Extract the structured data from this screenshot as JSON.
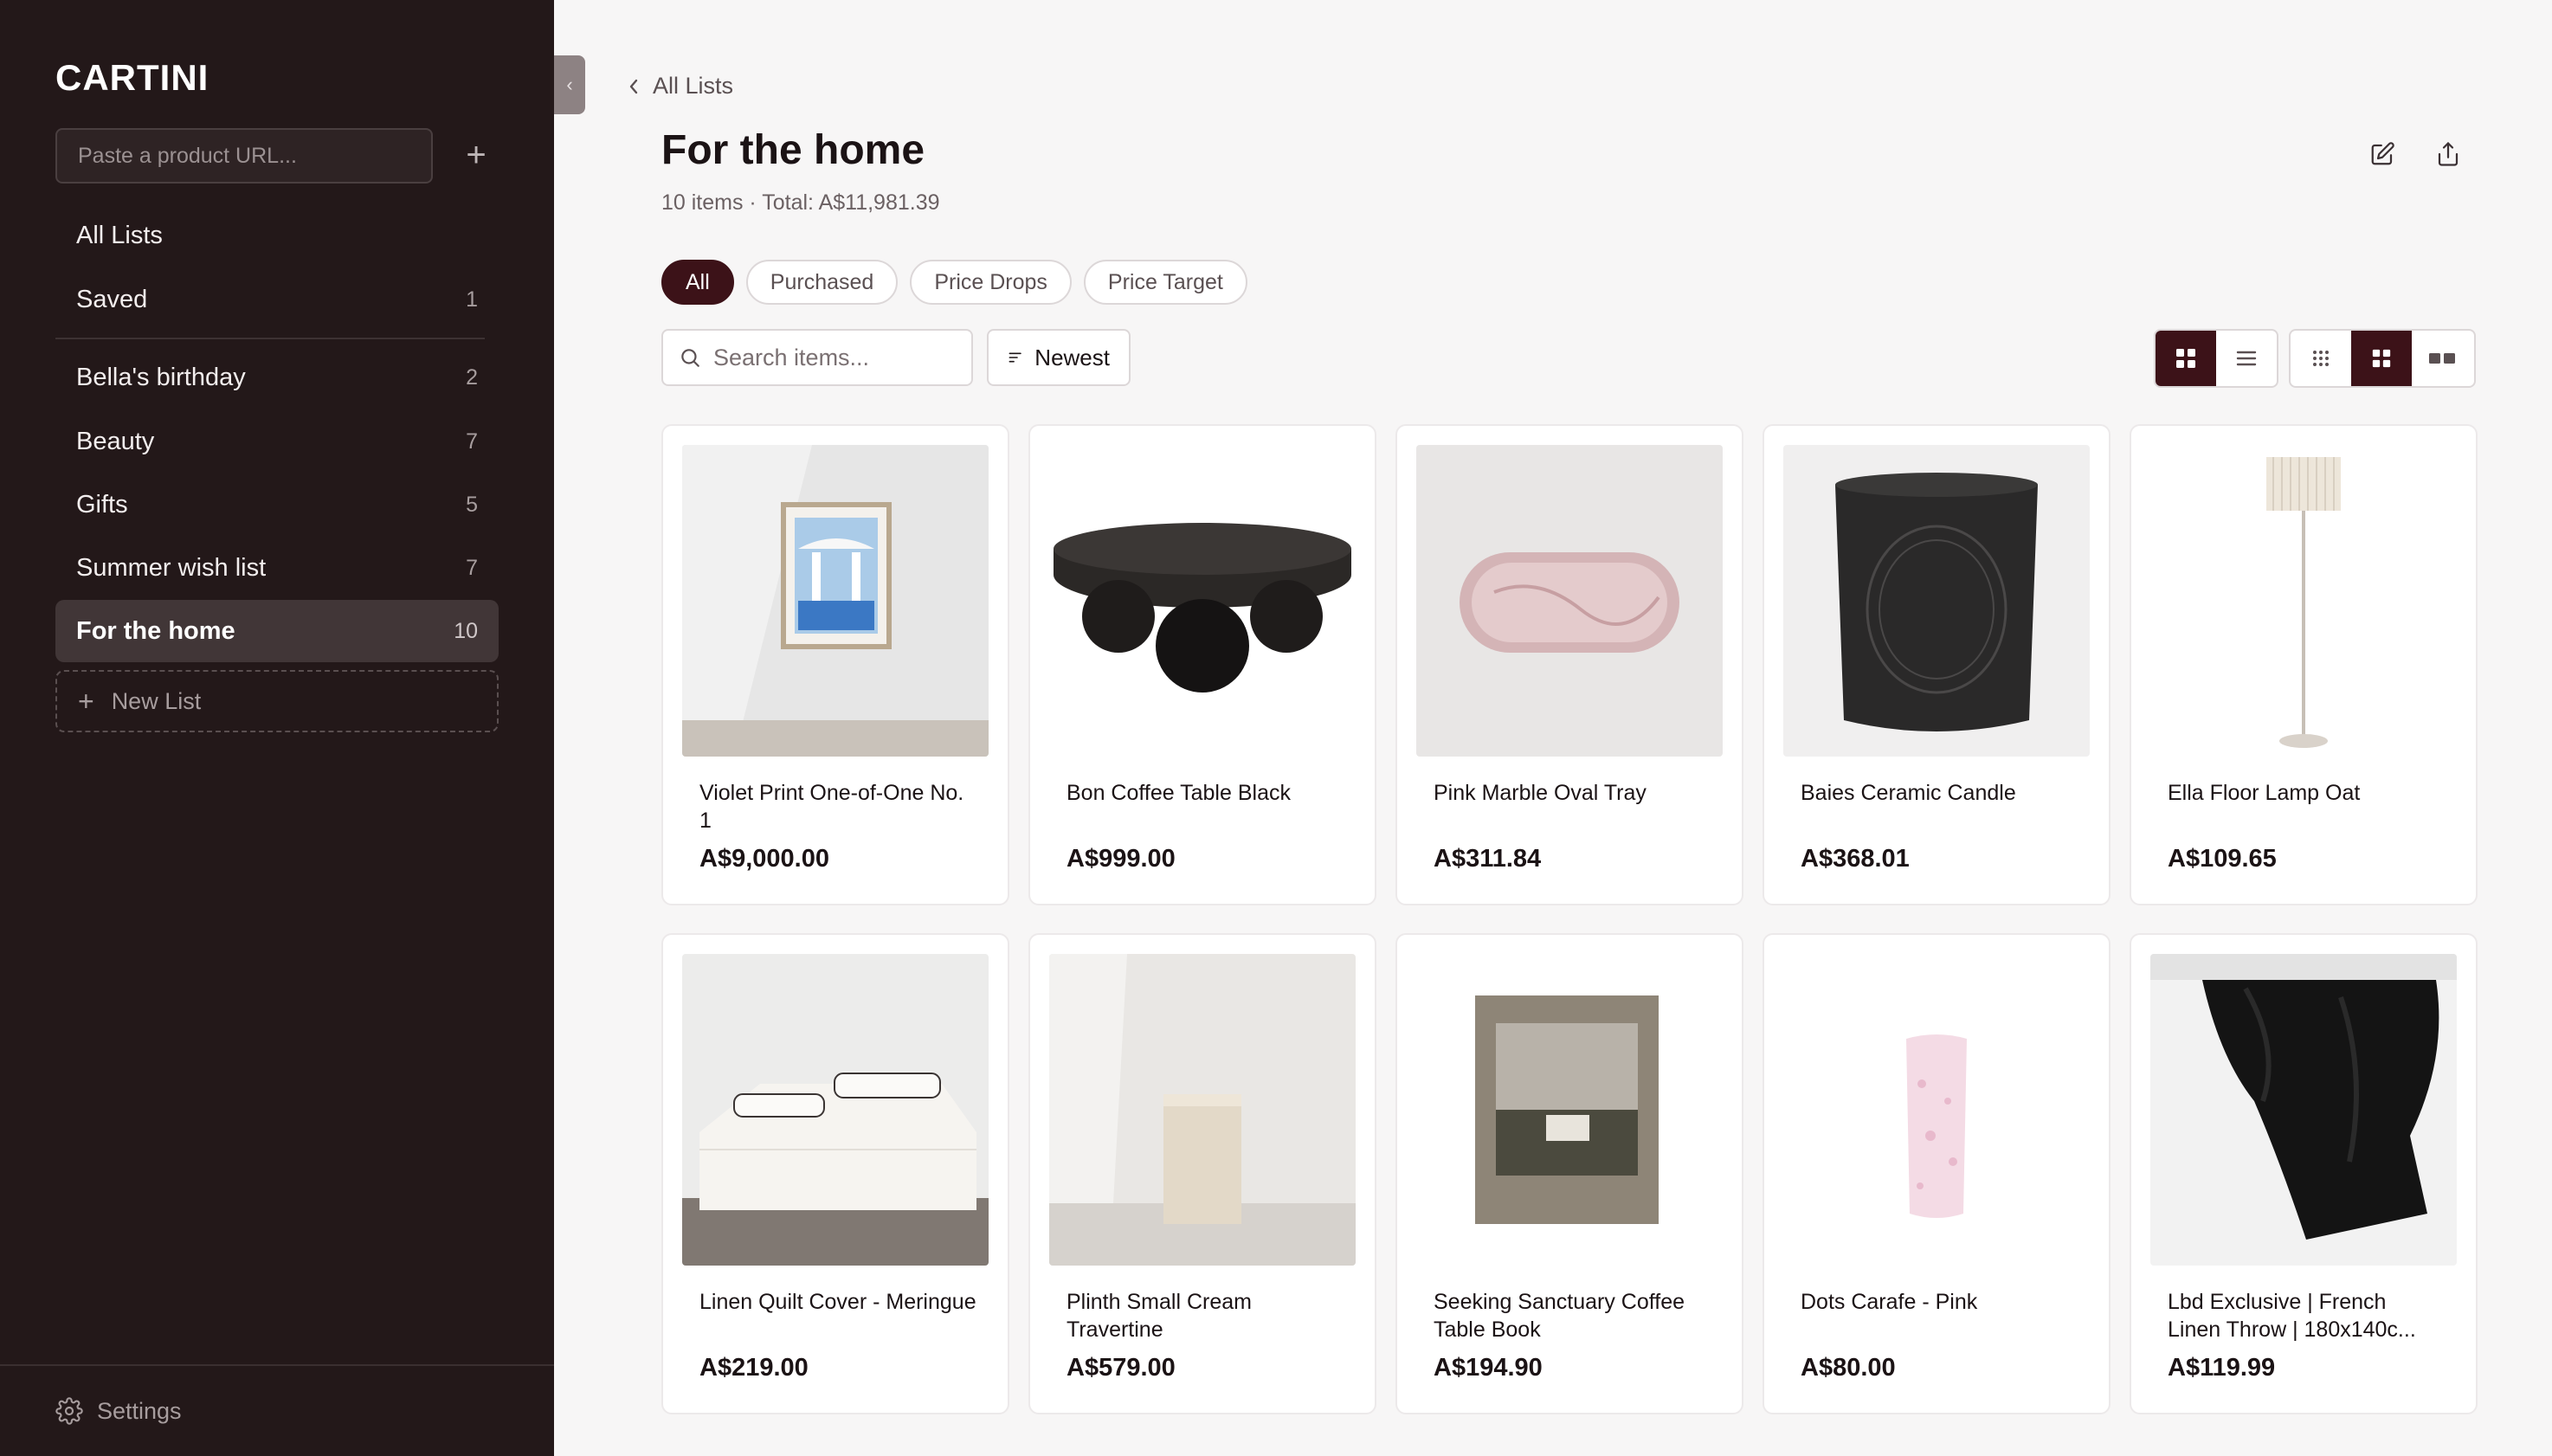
{
  "app": {
    "logo": "CARTINI"
  },
  "sidebar": {
    "url_placeholder": "Paste a product URL...",
    "nav_top": [
      {
        "label": "All Lists",
        "count": ""
      },
      {
        "label": "Saved",
        "count": "1"
      }
    ],
    "lists": [
      {
        "label": "Bella's birthday",
        "count": "2"
      },
      {
        "label": "Beauty",
        "count": "7"
      },
      {
        "label": "Gifts",
        "count": "5"
      },
      {
        "label": "Summer wish list",
        "count": "7"
      },
      {
        "label": "For the home",
        "count": "10",
        "active": true
      }
    ],
    "new_list": "New List",
    "settings": "Settings"
  },
  "main": {
    "breadcrumb": "All Lists",
    "title": "For the home",
    "subtitle": "10 items · Total: A$11,981.39",
    "filters": [
      "All",
      "Purchased",
      "Price Drops",
      "Price Target"
    ],
    "active_filter": "All",
    "search_placeholder": "Search items...",
    "sort_label": "Newest",
    "view_mode": "grid",
    "grid_density": "medium"
  },
  "items": [
    {
      "name": "Violet Print One-of-One No. 1",
      "price": "A$9,000.00"
    },
    {
      "name": "Bon Coffee Table Black",
      "price": "A$999.00"
    },
    {
      "name": "Pink Marble Oval Tray",
      "price": "A$311.84"
    },
    {
      "name": "Baies Ceramic Candle",
      "price": "A$368.01"
    },
    {
      "name": "Ella Floor Lamp Oat",
      "price": "A$109.65"
    },
    {
      "name": "Linen Quilt Cover - Meringue",
      "price": "A$219.00"
    },
    {
      "name": "Plinth Small Cream Travertine",
      "price": "A$579.00"
    },
    {
      "name": "Seeking Sanctuary Coffee Table Book",
      "price": "A$194.90"
    },
    {
      "name": "Dots Carafe - Pink",
      "price": "A$80.00"
    },
    {
      "name": "Lbd Exclusive | French Linen Throw | 180x140c...",
      "price": "A$119.99"
    }
  ],
  "colors": {
    "sidebar_bg": "#231819",
    "accent": "#3c1218",
    "page_bg": "#f7f6f6"
  }
}
